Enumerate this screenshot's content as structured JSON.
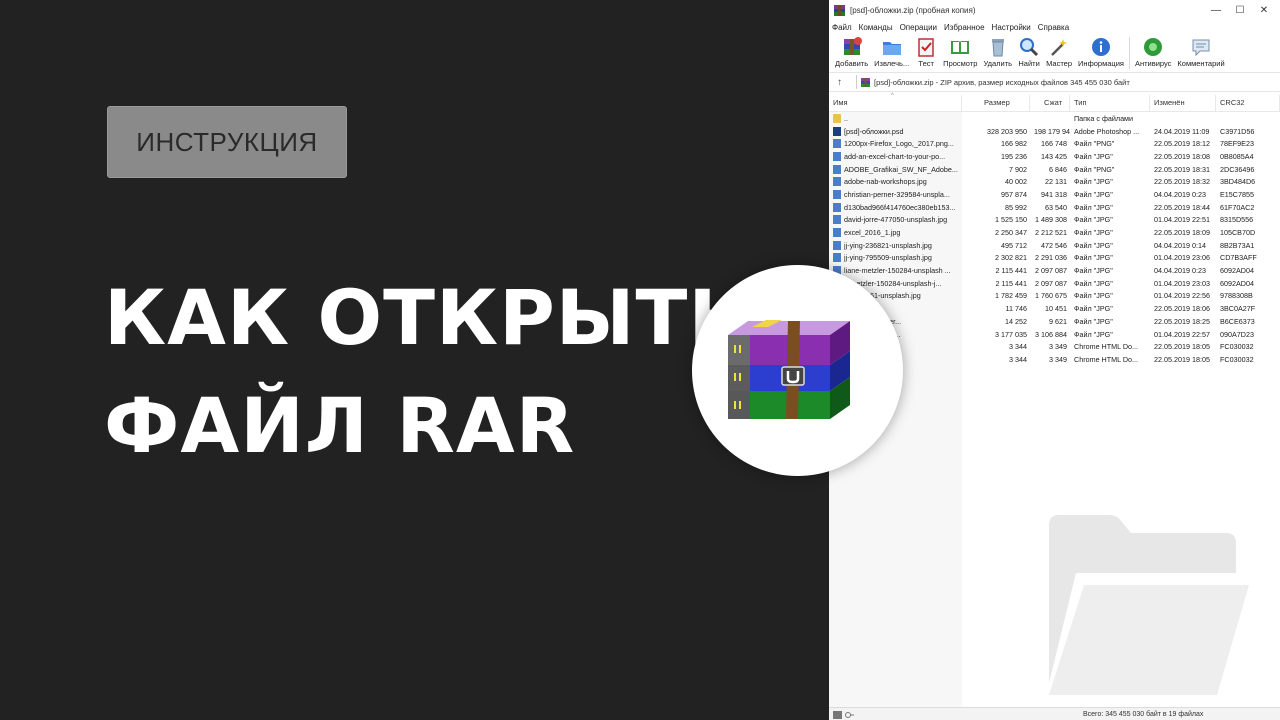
{
  "promo": {
    "badge": "ИНСТРУКЦИЯ",
    "headline_line1": "КАК ОТКРЫТЬ",
    "headline_line2": "ФАЙЛ RAR"
  },
  "window": {
    "title": "[psd]-обложки.zip (пробная копия)",
    "controls": {
      "minimize": "—",
      "maximize": "☐",
      "close": "✕"
    },
    "menu": [
      "Файл",
      "Команды",
      "Операции",
      "Избранное",
      "Настройки",
      "Справка"
    ],
    "toolbar": [
      {
        "label": "Добавить",
        "icon": "add-archive-icon"
      },
      {
        "label": "Извлечь...",
        "icon": "extract-folder-icon"
      },
      {
        "label": "Тест",
        "icon": "test-clipboard-icon"
      },
      {
        "label": "Просмотр",
        "icon": "view-book-icon"
      },
      {
        "label": "Удалить",
        "icon": "trash-icon"
      },
      {
        "label": "Найти",
        "icon": "magnifier-icon"
      },
      {
        "label": "Мастер",
        "icon": "magic-wand-icon"
      },
      {
        "label": "Информация",
        "icon": "info-icon"
      },
      {
        "label": "Антивирус",
        "icon": "antivirus-icon"
      },
      {
        "label": "Комментарий",
        "icon": "comment-icon"
      }
    ],
    "path": "[psd]-обложки.zip - ZIP архив, размер исходных файлов 345 455 030 байт",
    "up_arrow": "↑",
    "columns": [
      "Имя",
      "Размер",
      "Сжат",
      "Тип",
      "Изменён",
      "CRC32"
    ],
    "sort_indicator": "^",
    "rows": [
      {
        "name": "..",
        "size": "",
        "packed": "",
        "type": "Папка с файлами",
        "modified": "",
        "crc": "",
        "icon": "folder-icon"
      },
      {
        "name": "[psd]-обложки.psd",
        "size": "328 203 950",
        "packed": "198 179 948",
        "type": "Adobe Photoshop ...",
        "modified": "24.04.2019 11:09",
        "crc": "C3971D56",
        "icon": "psd-file-icon"
      },
      {
        "name": "1200px-Firefox_Logo,_2017.png...",
        "size": "166 982",
        "packed": "166 748",
        "type": "Файл \"PNG\"",
        "modified": "22.05.2019 18:12",
        "crc": "78EF9E23",
        "icon": "image-file-icon"
      },
      {
        "name": "add-an-excel-chart-to-your-po...",
        "size": "195 236",
        "packed": "143 425",
        "type": "Файл \"JPG\"",
        "modified": "22.05.2019 18:08",
        "crc": "0B8085A4",
        "icon": "image-file-icon"
      },
      {
        "name": "ADOBE_Grafikai_SW_NF_Adobe...",
        "size": "7 902",
        "packed": "6 846",
        "type": "Файл \"PNG\"",
        "modified": "22.05.2019 18:31",
        "crc": "2DC36496",
        "icon": "image-file-icon"
      },
      {
        "name": "adobe-nab-workshops.jpg",
        "size": "40 002",
        "packed": "22 131",
        "type": "Файл \"JPG\"",
        "modified": "22.05.2019 18:32",
        "crc": "3BD484D6",
        "icon": "image-file-icon"
      },
      {
        "name": "christian-perner-329584-unspla...",
        "size": "957 874",
        "packed": "941 318",
        "type": "Файл \"JPG\"",
        "modified": "04.04.2019 0:23",
        "crc": "E15C7855",
        "icon": "image-file-icon"
      },
      {
        "name": "d130bad966f414760ec380eb153...",
        "size": "85 992",
        "packed": "63 540",
        "type": "Файл \"JPG\"",
        "modified": "22.05.2019 18:44",
        "crc": "61F70AC2",
        "icon": "image-file-icon"
      },
      {
        "name": "david-jorre-477050-unsplash.jpg",
        "size": "1 525 150",
        "packed": "1 489 308",
        "type": "Файл \"JPG\"",
        "modified": "01.04.2019 22:51",
        "crc": "8315D556",
        "icon": "image-file-icon"
      },
      {
        "name": "excel_2016_1.jpg",
        "size": "2 250 347",
        "packed": "2 212 521",
        "type": "Файл \"JPG\"",
        "modified": "22.05.2019 18:09",
        "crc": "105CB70D",
        "icon": "image-file-icon"
      },
      {
        "name": "jj-ying-236821-unsplash.jpg",
        "size": "495 712",
        "packed": "472 546",
        "type": "Файл \"JPG\"",
        "modified": "04.04.2019 0:14",
        "crc": "8B2B73A1",
        "icon": "image-file-icon"
      },
      {
        "name": "jj-ying-795509-unsplash.jpg",
        "size": "2 302 821",
        "packed": "2 291 036",
        "type": "Файл \"JPG\"",
        "modified": "01.04.2019 23:06",
        "crc": "CD7B3AFF",
        "icon": "image-file-icon"
      },
      {
        "name": "liane-metzler-150284-unsplash ...",
        "size": "2 115 441",
        "packed": "2 097 087",
        "type": "Файл \"JPG\"",
        "modified": "04.04.2019 0:23",
        "crc": "6092AD04",
        "icon": "image-file-icon"
      },
      {
        "name": "e-metzler-150284-unsplash-j...",
        "size": "2 115 441",
        "packed": "2 097 087",
        "type": "Файл \"JPG\"",
        "modified": "01.04.2019 23:03",
        "crc": "6092AD04",
        "icon": "image-file-icon"
      },
      {
        "name": "vo-198061-unsplash.jpg",
        "size": "1 782 459",
        "packed": "1 760 675",
        "type": "Файл \"JPG\"",
        "modified": "01.04.2019 22:56",
        "crc": "9788308B",
        "icon": "image-file-icon"
      },
      {
        "name": "xcel.jpg",
        "size": "11 746",
        "packed": "10 451",
        "type": "Файл \"JPG\"",
        "modified": "22.05.2019 18:06",
        "crc": "3BC0A27F",
        "icon": "image-file-icon"
      },
      {
        "name": "obe-flash-player...",
        "size": "14 252",
        "packed": "9 621",
        "type": "Файл \"JPG\"",
        "modified": "22.05.2019 18:25",
        "crc": "B6CE6373",
        "icon": "image-file-icon"
      },
      {
        "name": "angel-204573-u...",
        "size": "3 177 035",
        "packed": "3 106 884",
        "type": "Файл \"JPG\"",
        "modified": "01.04.2019 22:57",
        "crc": "090A7D23",
        "icon": "image-file-icon"
      },
      {
        "name": "bp",
        "size": "3 344",
        "packed": "3 349",
        "type": "Chrome HTML Do...",
        "modified": "22.05.2019 18:05",
        "crc": "FC030032",
        "icon": "html-file-icon"
      },
      {
        "name": "",
        "size": "3 344",
        "packed": "3 349",
        "type": "Chrome HTML Do...",
        "modified": "22.05.2019 18:05",
        "crc": "FC030032",
        "icon": "html-file-icon"
      }
    ],
    "status_total": "Всего: 345 455 030 байт в 19 файлах"
  }
}
